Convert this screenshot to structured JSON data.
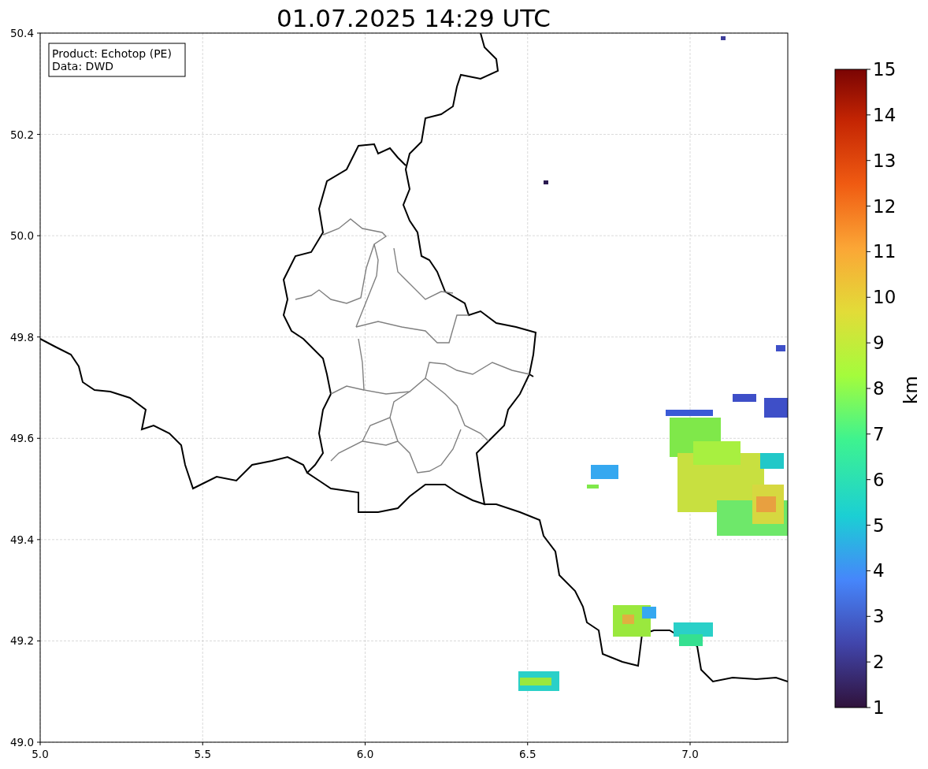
{
  "title": "01.07.2025 14:29 UTC",
  "info_box": [
    "Product: Echotop (PE)",
    "Data: DWD"
  ],
  "x_ticks": [
    "5.0",
    "5.5",
    "6.0",
    "6.5",
    "7.0"
  ],
  "y_ticks": [
    "50.4",
    "50.2",
    "50.0",
    "49.8",
    "49.6",
    "49.4",
    "49.2",
    "49.0"
  ],
  "colorbar": {
    "ticks": [
      "15",
      "14",
      "13",
      "12",
      "11",
      "10",
      "9",
      "8",
      "7",
      "6",
      "5",
      "4",
      "3",
      "2",
      "1"
    ],
    "label": "km"
  }
}
